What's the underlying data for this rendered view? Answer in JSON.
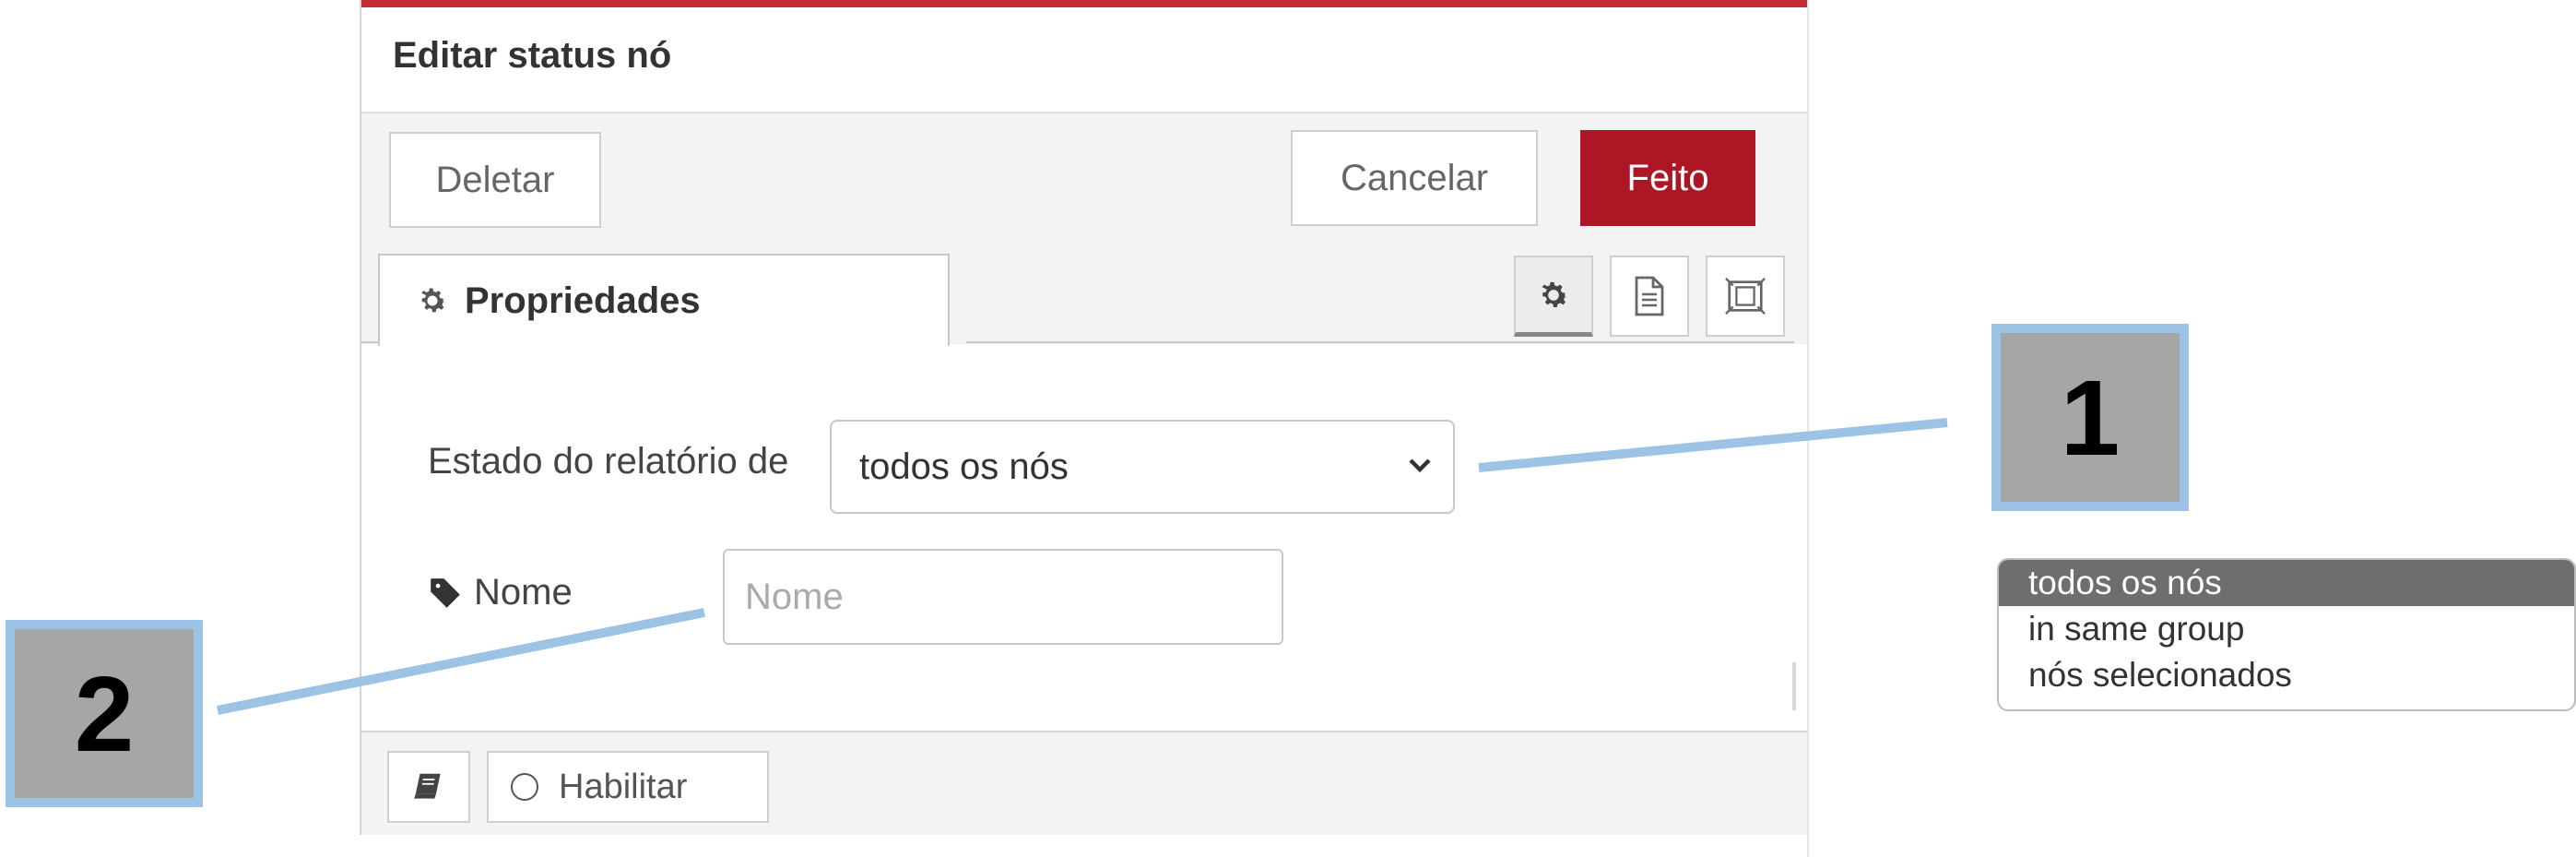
{
  "dialog": {
    "title": "Editar status nó",
    "accent_color": "#ad1625",
    "buttons": {
      "delete": "Deletar",
      "cancel": "Cancelar",
      "done": "Feito"
    },
    "tabs": [
      {
        "label": "Propriedades",
        "icon": "gear-icon"
      }
    ],
    "tab_icons": [
      "gear-icon",
      "document-icon",
      "frame-icon"
    ],
    "form": {
      "scope_label": "Estado do relatório de",
      "scope_value": "todos os nós",
      "name_label": "Nome",
      "name_placeholder": "Nome",
      "name_value": ""
    },
    "footer": {
      "book_icon": "book-icon",
      "toggle_label": "Habilitar"
    }
  },
  "callouts": [
    "1",
    "2"
  ],
  "dropdown_options": [
    {
      "label": "todos os nós",
      "selected": true
    },
    {
      "label": "in same group",
      "selected": false
    },
    {
      "label": "nós selecionados",
      "selected": false
    }
  ],
  "colors": {
    "callout_border": "#9cc3e5",
    "callout_fill": "#a6a6a6"
  }
}
